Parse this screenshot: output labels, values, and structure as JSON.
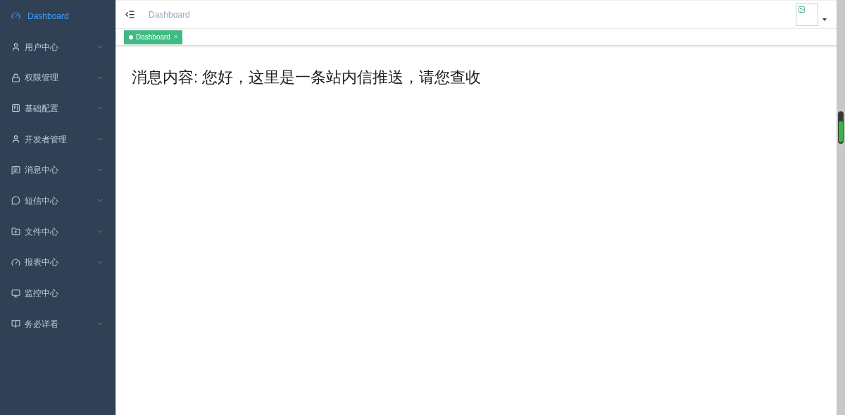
{
  "sidebar": {
    "items": [
      {
        "label": "Dashboard",
        "selected": true,
        "expandable": false
      },
      {
        "label": "用户中心",
        "selected": false,
        "expandable": true
      },
      {
        "label": "权限管理",
        "selected": false,
        "expandable": true
      },
      {
        "label": "基础配置",
        "selected": false,
        "expandable": true
      },
      {
        "label": "开发者管理",
        "selected": false,
        "expandable": true
      },
      {
        "label": "消息中心",
        "selected": false,
        "expandable": true
      },
      {
        "label": "短信中心",
        "selected": false,
        "expandable": true
      },
      {
        "label": "文件中心",
        "selected": false,
        "expandable": true
      },
      {
        "label": "报表中心",
        "selected": false,
        "expandable": true
      },
      {
        "label": "监控中心",
        "selected": false,
        "expandable": false
      },
      {
        "label": "务必详看",
        "selected": false,
        "expandable": true
      }
    ]
  },
  "header": {
    "breadcrumb": "Dashboard"
  },
  "tabs": [
    {
      "label": "Dashboard",
      "selected": true,
      "close": "×"
    }
  ],
  "content": {
    "message": "消息内容: 您好，这里是一条站内信推送，请您查收"
  }
}
